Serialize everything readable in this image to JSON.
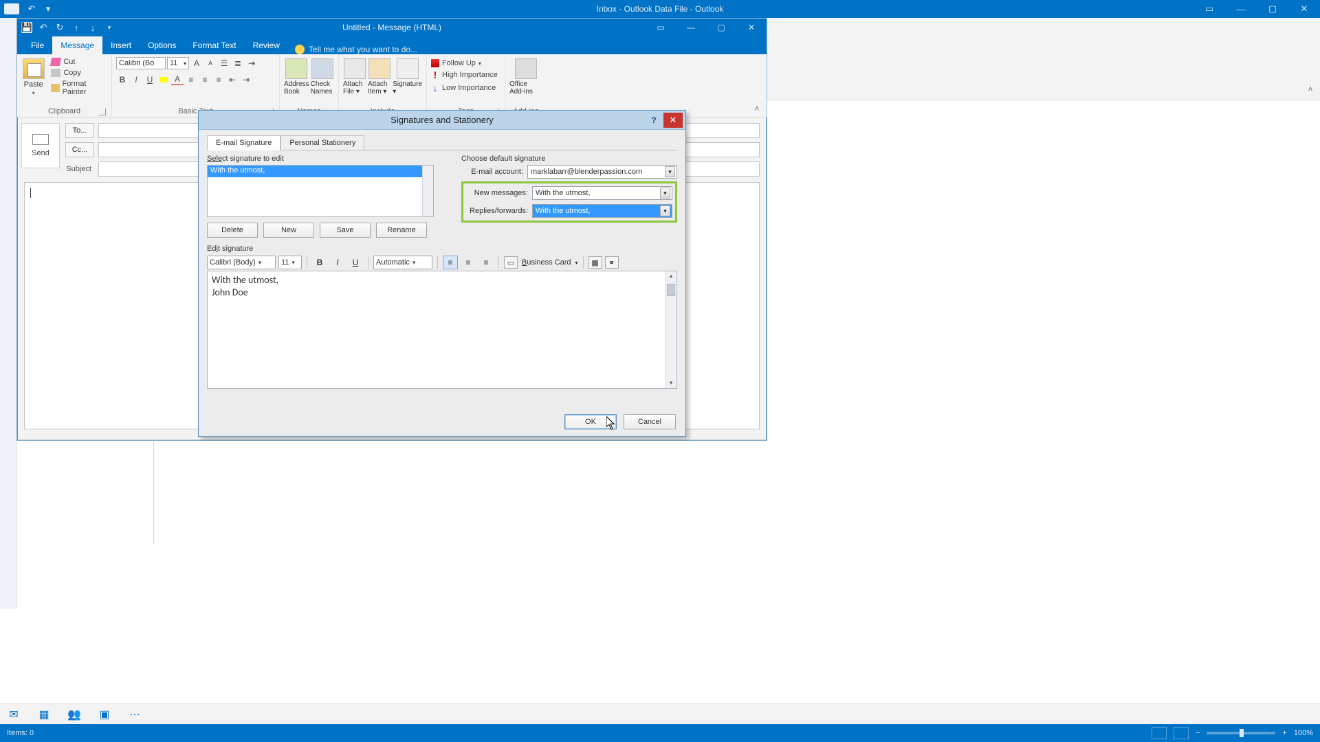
{
  "main_window": {
    "title": "Inbox - Outlook Data File - Outlook"
  },
  "message_window": {
    "title": "Untitled - Message (HTML)",
    "tabs": [
      "File",
      "Message",
      "Insert",
      "Options",
      "Format Text",
      "Review"
    ],
    "active_tab": "Message",
    "tell_me": "Tell me what you want to do...",
    "clipboard": {
      "paste": "Paste",
      "cut": "Cut",
      "copy": "Copy",
      "format_painter": "Format Painter",
      "label": "Clipboard"
    },
    "basic_text": {
      "font": "Calibri (Bo",
      "size": "11",
      "label": "Basic Text"
    },
    "names": {
      "address_book": "Address Book",
      "check_names": "Check Names",
      "label": "Names"
    },
    "include": {
      "attach_file": "Attach File",
      "attach_item": "Attach Item",
      "signature": "Signature",
      "label": "Include"
    },
    "tags": {
      "follow_up": "Follow Up",
      "high": "High Importance",
      "low": "Low Importance",
      "label": "Tags"
    },
    "addins": {
      "office": "Office Add-ins",
      "label": "Add-ins"
    },
    "fields": {
      "send": "Send",
      "to": "To...",
      "cc": "Cc...",
      "subject": "Subject"
    }
  },
  "dialog": {
    "title": "Signatures and Stationery",
    "tabs": {
      "email": "E-mail Signature",
      "stationery": "Personal Stationery"
    },
    "select_label": "Select signature to edit",
    "list_item": "With the utmost,",
    "buttons": {
      "delete": "Delete",
      "new": "New",
      "save": "Save",
      "rename": "Rename"
    },
    "default_label": "Choose default signature",
    "account_label": "E-mail account:",
    "account_value": "marklabarr@blenderpassion.com",
    "new_msg_label": "New messages:",
    "new_msg_value": "With the utmost,",
    "replies_label": "Replies/forwards:",
    "replies_value": "With the utmost,",
    "edit_label": "Edit signature",
    "toolbar": {
      "font": "Calibri (Body)",
      "size": "11",
      "color": "Automatic",
      "biz": "Business Card"
    },
    "body_line1": "With the utmost,",
    "body_line2": "John Doe",
    "ok": "OK",
    "cancel": "Cancel"
  },
  "status": {
    "items": "Items: 0",
    "zoom": "100%"
  }
}
